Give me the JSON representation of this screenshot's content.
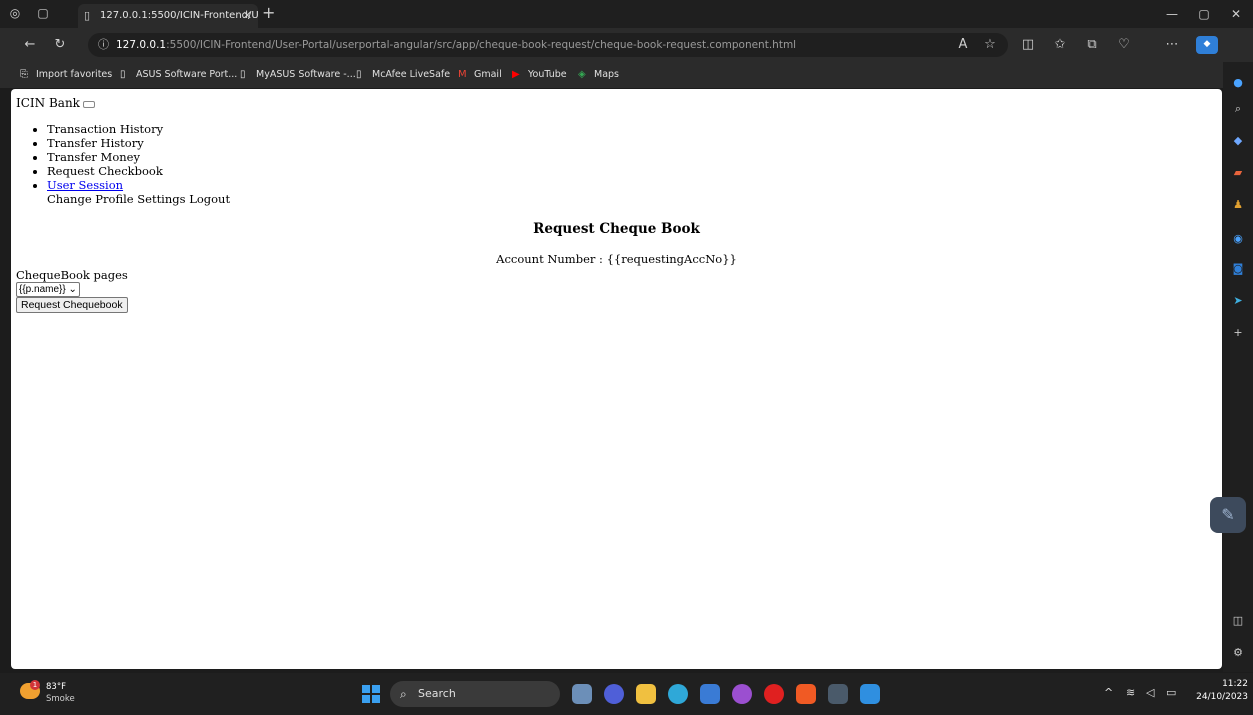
{
  "browser": {
    "tab_title": "127.0.0.1:5500/ICIN-Frontend/Us",
    "address_host": "127.0.0.1",
    "address_rest": ":5500/ICIN-Frontend/User-Portal/userportal-angular/src/app/cheque-book-request/cheque-book-request.component.html",
    "bookmarks": [
      {
        "label": "Import favorites",
        "icon": "import-icon"
      },
      {
        "label": "ASUS Software Port...",
        "icon": "page-icon"
      },
      {
        "label": "MyASUS Software -...",
        "icon": "page-icon"
      },
      {
        "label": "McAfee LiveSafe",
        "icon": "page-icon"
      },
      {
        "label": "Gmail",
        "icon": "gmail-icon"
      },
      {
        "label": "YouTube",
        "icon": "youtube-icon"
      },
      {
        "label": "Maps",
        "icon": "maps-icon"
      }
    ]
  },
  "page": {
    "brand": "ICIN Bank",
    "nav_items": [
      "Transaction History",
      "Transfer History",
      "Transfer Money",
      "Request Checkbook"
    ],
    "nav_link": "User Session",
    "nav_extra": "Change Profile Settings Logout",
    "heading": "Request Cheque Book",
    "account_line": "Account Number :  {{requestingAccNo}}",
    "pages_label": "ChequeBook pages",
    "pages_select_value": "{{p.name}}",
    "request_button": "Request Chequebook"
  },
  "taskbar": {
    "weather_badge": "1",
    "temperature": "83°F",
    "weather": "Smoke",
    "search": "Search",
    "time": "11:22",
    "date": "24/10/2023"
  },
  "colors": {
    "link": "#0000ee",
    "browser_chrome": "#2b2b2b",
    "taskbar": "#202020"
  }
}
